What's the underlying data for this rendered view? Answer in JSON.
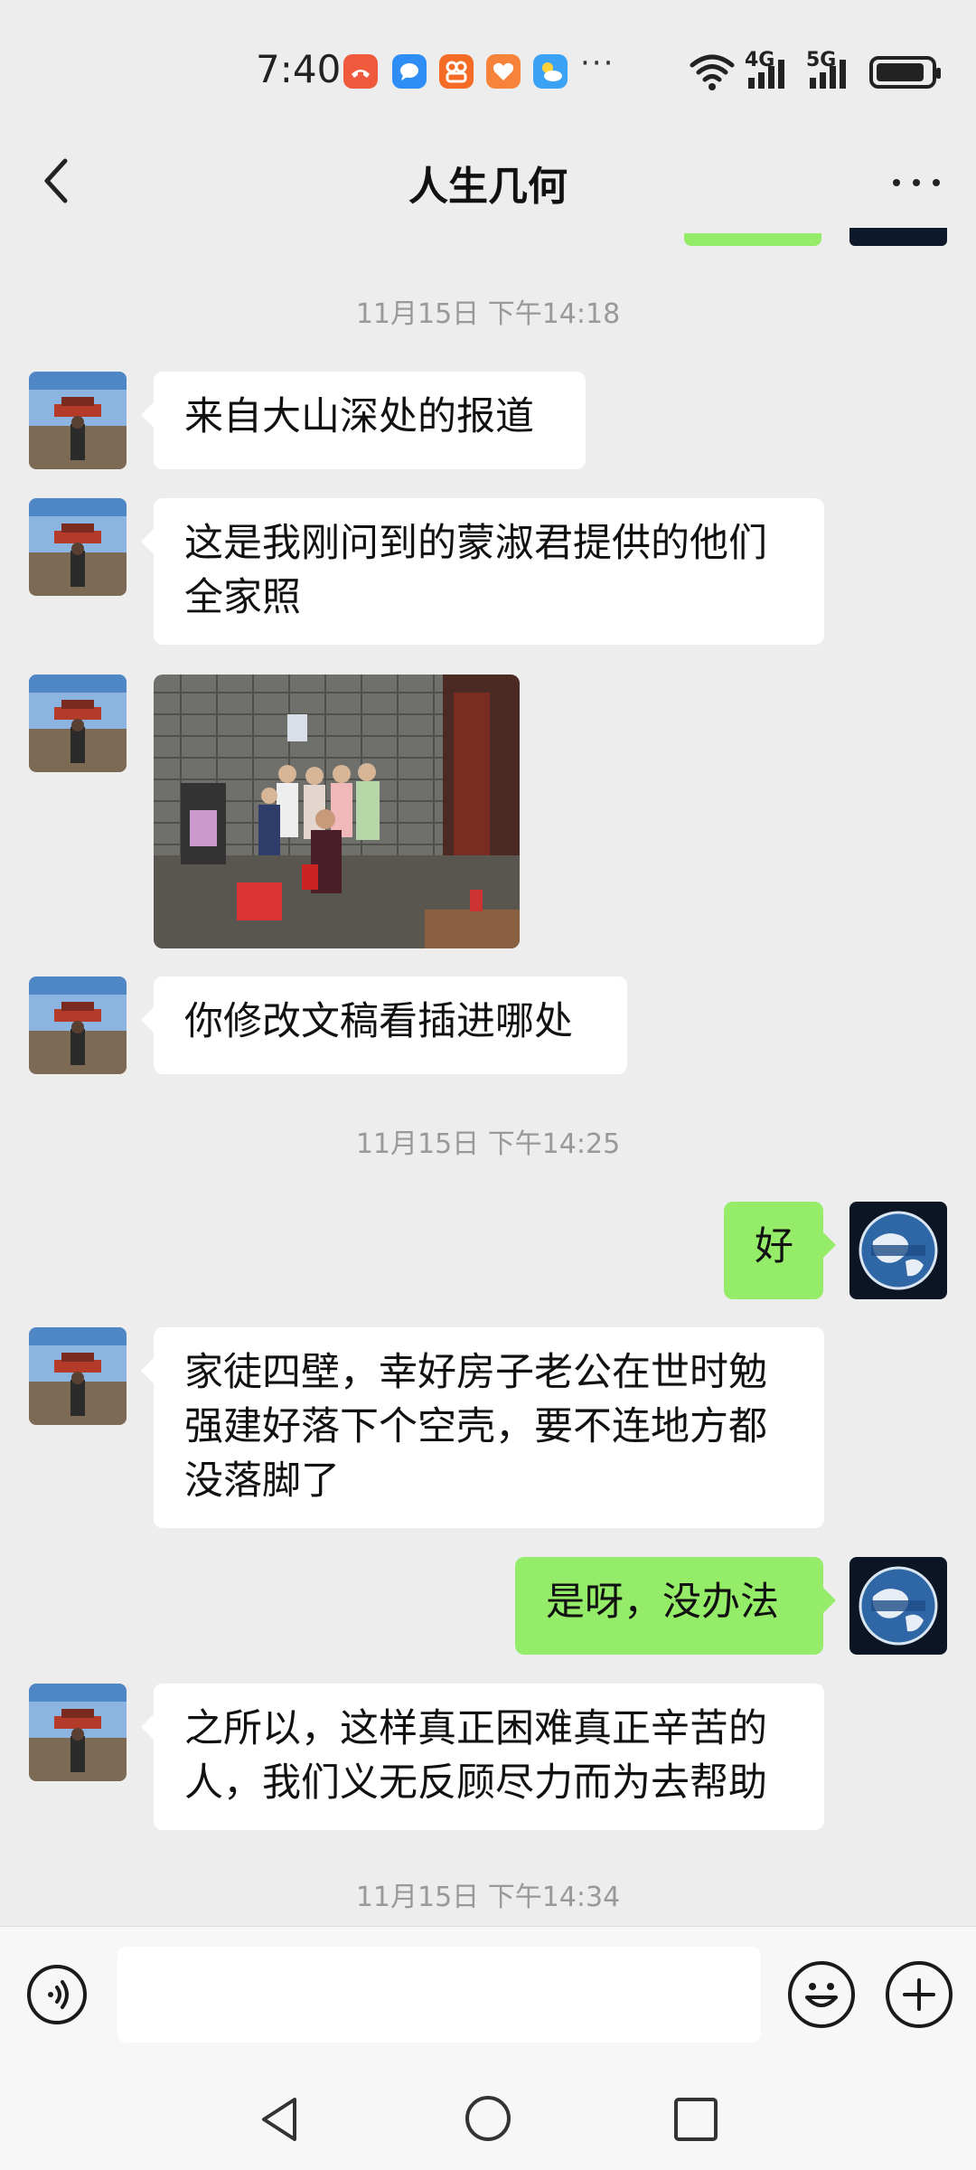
{
  "status_bar": {
    "time": "7:40",
    "more_indicator": "···",
    "network_4g": "4G",
    "network_5g": "5G",
    "icons": [
      "missed-call-icon",
      "message-icon",
      "app-icon",
      "health-icon",
      "weather-icon",
      "wifi-icon",
      "signal-icon",
      "battery-icon"
    ]
  },
  "header": {
    "title": "人生几何"
  },
  "messages": [
    {
      "type": "timestamp",
      "text": "11月15日 下午14:18"
    },
    {
      "type": "text",
      "side": "left",
      "text": "来自大山深处的报道"
    },
    {
      "type": "text",
      "side": "left",
      "lines": [
        "这是我刚问到的蒙淑君提供的他们",
        "全家照"
      ]
    },
    {
      "type": "image",
      "side": "left"
    },
    {
      "type": "text",
      "side": "left",
      "text": "你修改文稿看插进哪处"
    },
    {
      "type": "timestamp",
      "text": "11月15日 下午14:25"
    },
    {
      "type": "text",
      "side": "right",
      "text": "好"
    },
    {
      "type": "text",
      "side": "left",
      "lines": [
        "家徒四壁，幸好房子老公在世时勉",
        "强建好落下个空壳，要不连地方都",
        "没落脚了"
      ]
    },
    {
      "type": "text",
      "side": "right",
      "text": "是呀，没办法"
    },
    {
      "type": "text",
      "side": "left",
      "lines": [
        "之所以，这样真正困难真正辛苦的",
        "人，我们义无反顾尽力而为去帮助"
      ]
    },
    {
      "type": "timestamp",
      "text": "11月15日 下午14:34"
    }
  ],
  "input_bar": {
    "value": "",
    "placeholder": ""
  },
  "colors": {
    "background": "#ededed",
    "bubble_self": "#95ec69",
    "bubble_other": "#ffffff",
    "timestamp": "#999999"
  }
}
